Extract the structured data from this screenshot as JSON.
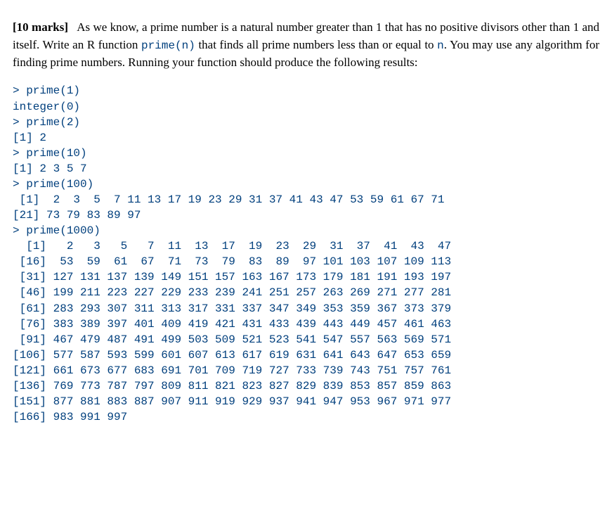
{
  "marks": "[10 marks]",
  "paragraph_prefix": "As we know, a prime number is a natural number greater than 1 that has no positive divisors other than 1 and itself.  Write an R function ",
  "func_name": "prime(n)",
  "paragraph_mid": " that finds all prime numbers less than or equal to ",
  "param": "n",
  "paragraph_tail": ".  You may use any algorithm for finding prime numbers.  Running your function should produce the following results:",
  "chart_data": {
    "type": "table",
    "title": "R console transcript of prime(n) outputs",
    "series": [
      {
        "name": "prime(1)",
        "values": []
      },
      {
        "name": "prime(2)",
        "values": [
          2
        ]
      },
      {
        "name": "prime(10)",
        "values": [
          2,
          3,
          5,
          7
        ]
      },
      {
        "name": "prime(100)",
        "values": [
          2,
          3,
          5,
          7,
          11,
          13,
          17,
          19,
          23,
          29,
          31,
          37,
          41,
          43,
          47,
          53,
          59,
          61,
          67,
          71,
          73,
          79,
          83,
          89,
          97
        ]
      },
      {
        "name": "prime(1000)",
        "values": [
          2,
          3,
          5,
          7,
          11,
          13,
          17,
          19,
          23,
          29,
          31,
          37,
          41,
          43,
          47,
          53,
          59,
          61,
          67,
          71,
          73,
          79,
          83,
          89,
          97,
          101,
          103,
          107,
          109,
          113,
          127,
          131,
          137,
          139,
          149,
          151,
          157,
          163,
          167,
          173,
          179,
          181,
          191,
          193,
          197,
          199,
          211,
          223,
          227,
          229,
          233,
          239,
          241,
          251,
          257,
          263,
          269,
          271,
          277,
          281,
          283,
          293,
          307,
          311,
          313,
          317,
          331,
          337,
          347,
          349,
          353,
          359,
          367,
          373,
          379,
          383,
          389,
          397,
          401,
          409,
          419,
          421,
          431,
          433,
          439,
          443,
          449,
          457,
          461,
          463,
          467,
          479,
          487,
          491,
          499,
          503,
          509,
          521,
          523,
          541,
          547,
          557,
          563,
          569,
          571,
          577,
          587,
          593,
          599,
          601,
          607,
          613,
          617,
          619,
          631,
          641,
          643,
          647,
          653,
          659,
          661,
          673,
          677,
          683,
          691,
          701,
          709,
          719,
          727,
          733,
          739,
          743,
          751,
          757,
          761,
          769,
          773,
          787,
          797,
          809,
          811,
          821,
          823,
          827,
          829,
          839,
          853,
          857,
          859,
          863,
          877,
          881,
          883,
          887,
          907,
          911,
          919,
          929,
          937,
          941,
          947,
          953,
          967,
          971,
          977,
          983,
          991,
          997
        ]
      }
    ]
  },
  "code_block": "> prime(1)\ninteger(0)\n> prime(2)\n[1] 2\n> prime(10)\n[1] 2 3 5 7\n> prime(100)\n [1]  2  3  5  7 11 13 17 19 23 29 31 37 41 43 47 53 59 61 67 71\n[21] 73 79 83 89 97\n> prime(1000)\n  [1]   2   3   5   7  11  13  17  19  23  29  31  37  41  43  47\n [16]  53  59  61  67  71  73  79  83  89  97 101 103 107 109 113\n [31] 127 131 137 139 149 151 157 163 167 173 179 181 191 193 197\n [46] 199 211 223 227 229 233 239 241 251 257 263 269 271 277 281\n [61] 283 293 307 311 313 317 331 337 347 349 353 359 367 373 379\n [76] 383 389 397 401 409 419 421 431 433 439 443 449 457 461 463\n [91] 467 479 487 491 499 503 509 521 523 541 547 557 563 569 571\n[106] 577 587 593 599 601 607 613 617 619 631 641 643 647 653 659\n[121] 661 673 677 683 691 701 709 719 727 733 739 743 751 757 761\n[136] 769 773 787 797 809 811 821 823 827 829 839 853 857 859 863\n[151] 877 881 883 887 907 911 919 929 937 941 947 953 967 971 977\n[166] 983 991 997"
}
